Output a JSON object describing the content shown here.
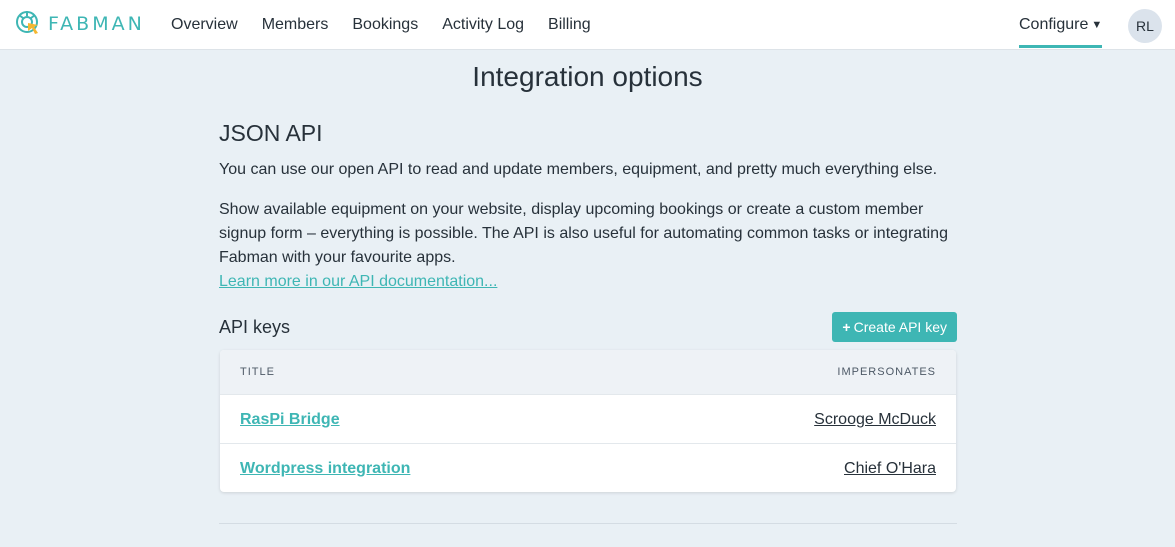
{
  "header": {
    "logo_text": "FABMAN",
    "nav": [
      {
        "label": "Overview"
      },
      {
        "label": "Members"
      },
      {
        "label": "Bookings"
      },
      {
        "label": "Activity Log"
      },
      {
        "label": "Billing"
      }
    ],
    "configure_label": "Configure",
    "avatar_initials": "RL"
  },
  "page": {
    "title": "Integration options"
  },
  "api_section": {
    "title": "JSON API",
    "paragraph1": "You can use our open API to read and update members, equipment, and pretty much everything else.",
    "paragraph2": "Show available equipment on your website, display upcoming bookings or create a custom member signup form – everything is possible. The API is also useful for automating common tasks or integrating Fabman with your favourite apps.",
    "doc_link": "Learn more in our API documentation..."
  },
  "api_keys": {
    "title": "API keys",
    "create_button": "Create API key",
    "columns": {
      "title": "TITLE",
      "impersonates": "IMPERSONATES"
    },
    "rows": [
      {
        "title": "RasPi Bridge",
        "impersonates": "Scrooge McDuck"
      },
      {
        "title": "Wordpress integration",
        "impersonates": "Chief O'Hara"
      }
    ]
  },
  "colors": {
    "accent": "#3eb6b4",
    "background": "#e9f0f5",
    "text": "#27313a"
  }
}
